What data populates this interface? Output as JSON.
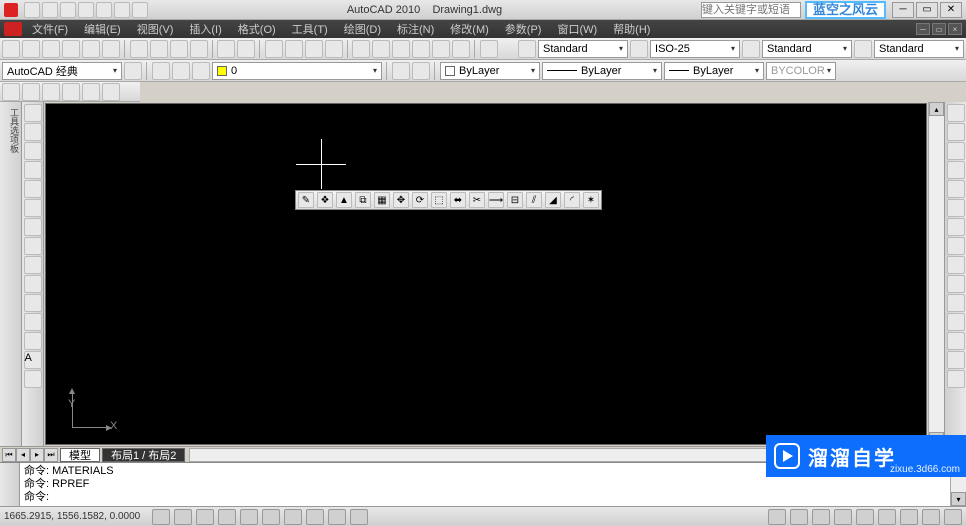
{
  "title": {
    "app": "AutoCAD 2010",
    "doc": "Drawing1.dwg",
    "search_placeholder": "键入关键字或短语"
  },
  "logo_badge": "蓝空之风云",
  "menus": [
    "文件(F)",
    "编辑(E)",
    "视图(V)",
    "插入(I)",
    "格式(O)",
    "工具(T)",
    "绘图(D)",
    "标注(N)",
    "修改(M)",
    "参数(P)",
    "窗口(W)",
    "帮助(H)"
  ],
  "row1": {
    "styles": {
      "text": "Standard",
      "dim": "ISO-25",
      "table": "Standard",
      "ml": "Standard"
    }
  },
  "row2": {
    "workspace": "AutoCAD 经典",
    "layer_combo": "0",
    "linetype": "ByLayer",
    "lineweight": "ByLayer",
    "color": "ByLayer",
    "plotstyle": "BYCOLOR"
  },
  "tabs": {
    "model": "模型",
    "layout1": "布局1 / 布局2"
  },
  "command": {
    "line1": "命令: MATERIALS",
    "line2": "命令: RPREF",
    "prompt": "命令:"
  },
  "status": {
    "coords": "1665.2915, 1556.1582, 0.0000"
  },
  "ucs": {
    "x": "X",
    "y": "Y"
  },
  "watermark": {
    "text": "溜溜自学",
    "url": "zixue.3d66.com"
  }
}
